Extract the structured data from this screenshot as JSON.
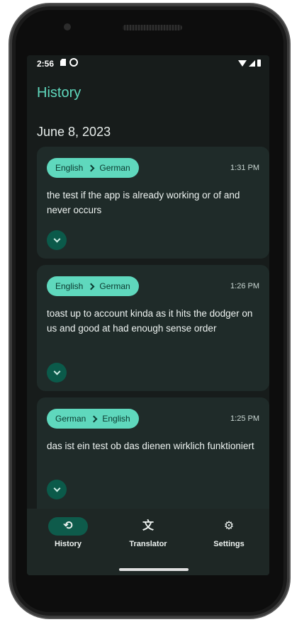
{
  "status_bar": {
    "time": "2:56"
  },
  "header": {
    "title": "History"
  },
  "date_group": "June 8, 2023",
  "history": [
    {
      "source_lang": "English",
      "target_lang": "German",
      "time": "1:31 PM",
      "text": "the test if the app is already working or of and never occurs"
    },
    {
      "source_lang": "English",
      "target_lang": "German",
      "time": "1:26 PM",
      "text": "toast up to account kinda as it hits the dodger on us and good at had enough sense order"
    },
    {
      "source_lang": "German",
      "target_lang": "English",
      "time": "1:25 PM",
      "text": "das ist ein test ob das dienen wirklich funktioniert"
    }
  ],
  "nav": [
    {
      "label": "History",
      "icon": "history-icon",
      "active": true
    },
    {
      "label": "Translator",
      "icon": "translate-icon",
      "active": false
    },
    {
      "label": "Settings",
      "icon": "gear-icon",
      "active": false
    }
  ],
  "colors": {
    "accent": "#5fd8bd",
    "background": "#171c1b",
    "card": "#1f2b29"
  }
}
